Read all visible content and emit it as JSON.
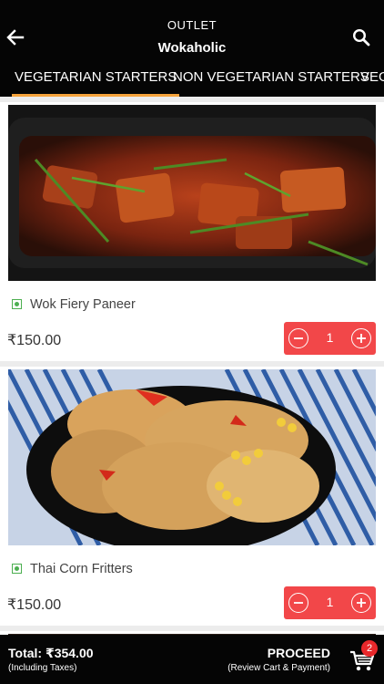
{
  "header": {
    "outlet_label": "OUTLET",
    "outlet_name": "Wokaholic",
    "back_icon": "arrow-left-icon",
    "search_icon": "search-icon"
  },
  "tabs": [
    {
      "label": "VEGETARIAN STARTERS",
      "active": true
    },
    {
      "label": "NON VEGETARIAN STARTERS",
      "active": false
    },
    {
      "label": "VEG",
      "active": false
    }
  ],
  "items": [
    {
      "name": "Wok Fiery Paneer",
      "price": "₹150.00",
      "qty": "1",
      "veg": true
    },
    {
      "name": "Thai Corn Fritters",
      "price": "₹150.00",
      "qty": "1",
      "veg": true
    }
  ],
  "footer": {
    "total": "Total: ₹354.00",
    "total_note": "(Including Taxes)",
    "proceed": "PROCEED",
    "proceed_note": "(Review Cart & Payment)",
    "cart_count": "2",
    "cart_icon": "cart-icon"
  },
  "colors": {
    "header_bg": "#050505",
    "tab_indicator": "#f6a33b",
    "qty_bg": "#f24749",
    "veg_mark": "#4caf50",
    "badge": "#e8282b"
  }
}
